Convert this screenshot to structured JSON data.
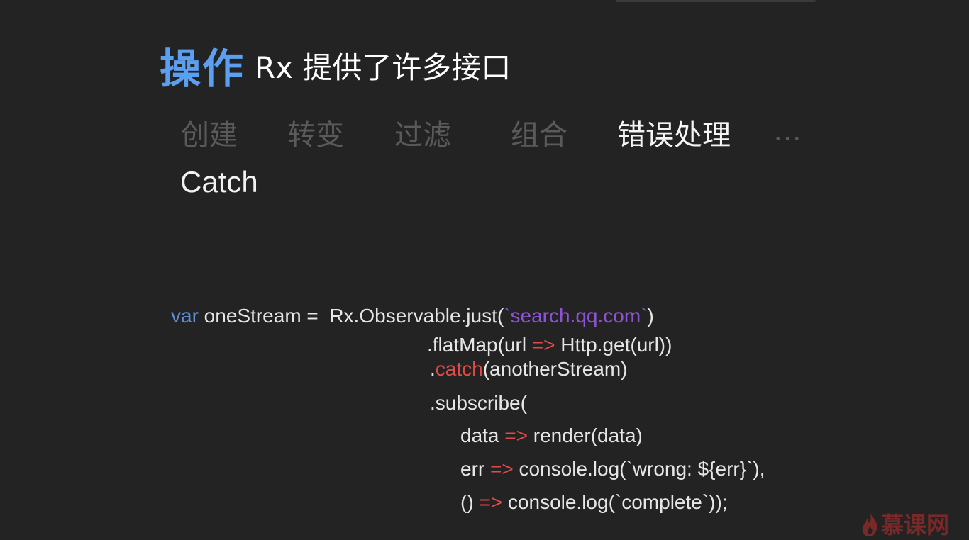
{
  "title": {
    "accent": "操作",
    "rest": "Rx 提供了许多接口"
  },
  "categories": [
    {
      "label": "创建",
      "active": false
    },
    {
      "label": "转变",
      "active": false
    },
    {
      "label": "过滤",
      "active": false
    },
    {
      "label": "组合",
      "active": false
    },
    {
      "label": "错误处理",
      "active": true
    },
    {
      "label": "…",
      "active": false
    }
  ],
  "subtitle": "Catch",
  "code": {
    "l1_kw": "var",
    "l1_a": " oneStream =  Rx.Observable.just(",
    "l1_str": "`search.qq.com`",
    "l1_b": ")",
    "l2_a": ".flatMap(url ",
    "l2_arrow": "=>",
    "l2_b": " Http.get(url))",
    "l3_a": ".",
    "l3_method": "catch",
    "l3_b": "(anotherStream)",
    "l4": ".subscribe(",
    "l5_a": "data ",
    "l5_arrow": "=>",
    "l5_b": " render(data)",
    "l6_a": "err ",
    "l6_arrow": "=>",
    "l6_b": " console.log(`wrong: ${err}`),",
    "l7_a": "() ",
    "l7_arrow": "=>",
    "l7_b": " console.log(`complete`));"
  },
  "watermark": {
    "text": "慕课网",
    "icon": "flame-icon",
    "color": "#8a2a2a"
  },
  "colors": {
    "background": "#232323",
    "accent_blue": "#5b9ff0",
    "keyword_blue": "#5f8fd9",
    "string_purple": "#8e52d6",
    "arrow_red": "#e04b47",
    "inactive_gray": "#5a5a5a"
  }
}
